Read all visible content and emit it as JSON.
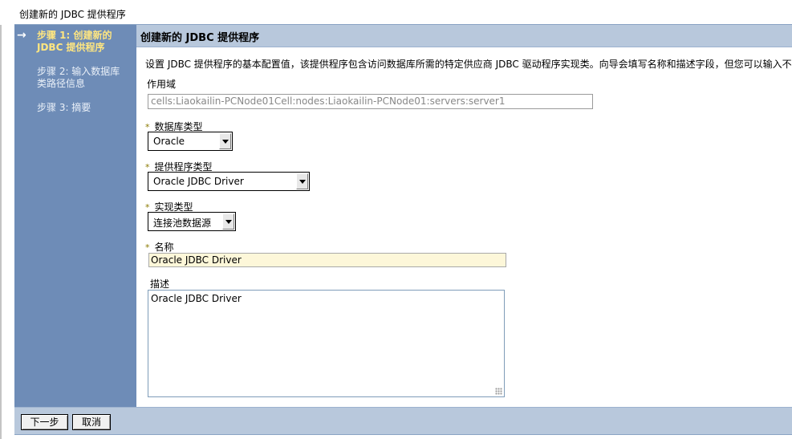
{
  "page": {
    "title": "创建新的 JDBC 提供程序"
  },
  "steps": [
    {
      "label": "步骤 1: 创建新的 JDBC 提供程序",
      "line1": "步骤 1: 创建新的",
      "line2": "JDBC 提供程序",
      "current": true
    },
    {
      "label": "步骤 2: 输入数据库类路径信息",
      "line1": "步骤 2: 输入数据库",
      "line2": "类路径信息",
      "current": false
    },
    {
      "label": "步骤 3: 摘要",
      "line1": "步骤 3: 摘要",
      "line2": "",
      "current": false
    }
  ],
  "content": {
    "header": "创建新的 JDBC 提供程序",
    "intro": "设置 JDBC 提供程序的基本配置值，该提供程序包含访问数据库所需的特定供应商 JDBC 驱动程序实现类。向导会填写名称和描述字段，但您可以输入不同值。"
  },
  "form": {
    "scope": {
      "label": "作用域",
      "value": "cells:Liaokailin-PCNode01Cell:nodes:Liaokailin-PCNode01:servers:server1"
    },
    "db_type": {
      "label": "数据库类型",
      "value": "Oracle",
      "required": "*"
    },
    "provider_type": {
      "label": "提供程序类型",
      "value": "Oracle JDBC Driver",
      "required": "*"
    },
    "impl_type": {
      "label": "实现类型",
      "value": "连接池数据源",
      "required": "*"
    },
    "name": {
      "label": "名称",
      "value": "Oracle JDBC Driver",
      "required": "*"
    },
    "description": {
      "label": "描述",
      "value": "Oracle JDBC Driver"
    }
  },
  "buttons": {
    "next": "下一步",
    "cancel": "取消"
  },
  "icons": {
    "current_step": "arrow-right-icon",
    "dropdown": "chevron-down-icon"
  },
  "colors": {
    "steps_bg": "#6e8cb7",
    "header_bg": "#b8c8dc",
    "current_step": "#ffe680",
    "required_mark": "#8a7a00",
    "name_field_bg": "#fdf7d9"
  }
}
